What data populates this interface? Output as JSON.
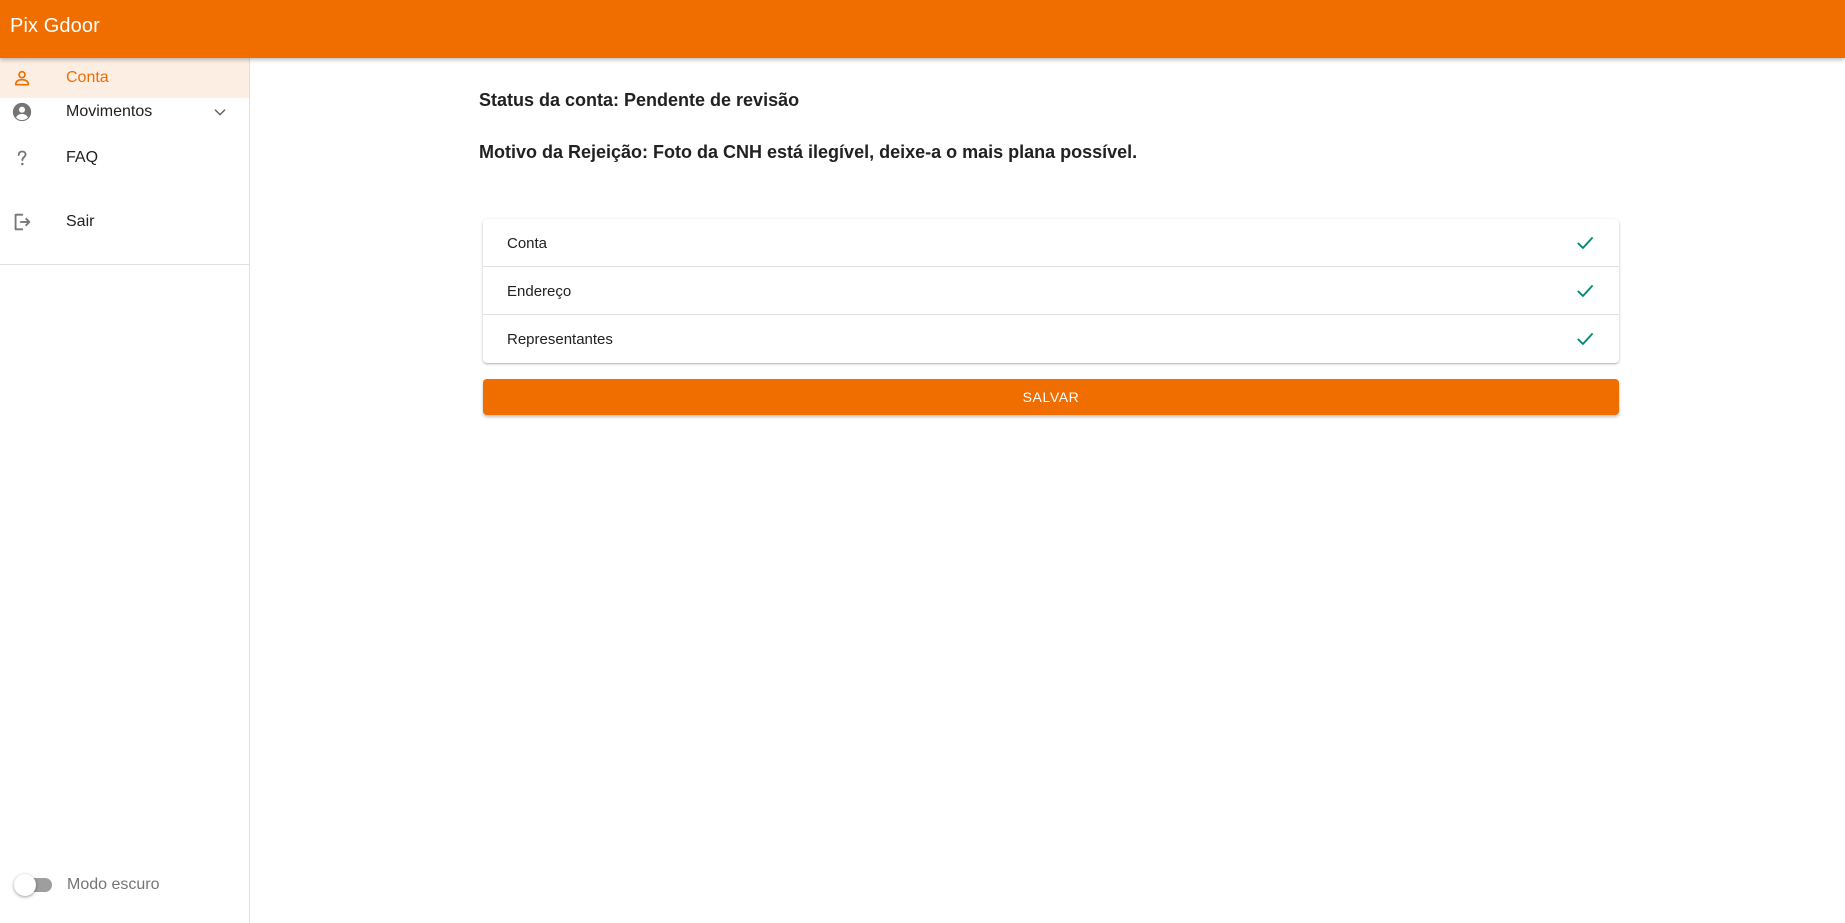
{
  "app": {
    "title": "Pix Gdoor",
    "brand_color": "#f06d00"
  },
  "sidebar": {
    "items": [
      {
        "label": "Conta",
        "icon": "person-outline-icon",
        "active": true
      },
      {
        "label": "Movimentos",
        "icon": "account-circle-icon",
        "expandable": true
      },
      {
        "label": "FAQ",
        "icon": "question-mark-icon"
      },
      {
        "label": "Sair",
        "icon": "logout-icon"
      }
    ],
    "dark_mode": {
      "label": "Modo escuro",
      "enabled": false
    }
  },
  "main": {
    "status_text": "Status da conta: Pendente de revisão",
    "reason_text": "Motivo da Rejeição: Foto da CNH está ilegível, deixe-a o mais plana possível.",
    "steps": [
      {
        "label": "Conta",
        "status": "check-icon"
      },
      {
        "label": "Endereço",
        "status": "check-icon"
      },
      {
        "label": "Representantes",
        "status": "check-icon"
      }
    ],
    "check_color": "#00897b",
    "save_label": "SALVAR"
  }
}
